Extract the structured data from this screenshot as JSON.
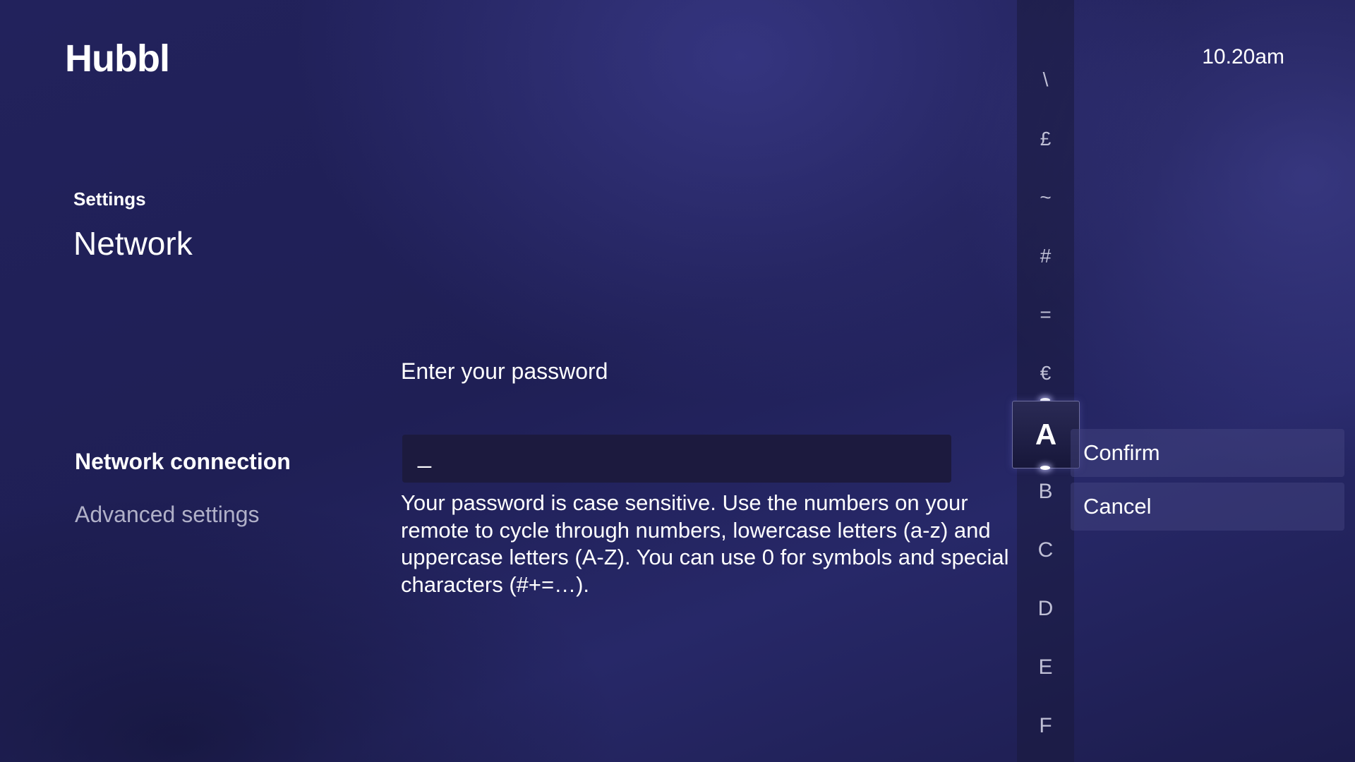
{
  "app": {
    "logo": "Hubbl",
    "clock": "10.20am"
  },
  "breadcrumb": "Settings",
  "page_title": "Network",
  "menu": {
    "items": [
      {
        "label": "Network connection",
        "active": true
      },
      {
        "label": "Advanced settings",
        "active": false
      }
    ]
  },
  "password": {
    "prompt": "Enter your password",
    "value": "_",
    "help": "Your password is case sensitive. Use the numbers on your remote to cycle through numbers, lowercase letters (a-z) and uppercase letters (A-Z). You can use 0 for symbols and special characters (#+=…)."
  },
  "char_picker": {
    "above": [
      "\\",
      "£",
      "~",
      "#",
      "=",
      "€"
    ],
    "selected": "A",
    "below": [
      "B",
      "C",
      "D",
      "E",
      "F"
    ]
  },
  "actions": {
    "confirm": "Confirm",
    "cancel": "Cancel"
  }
}
